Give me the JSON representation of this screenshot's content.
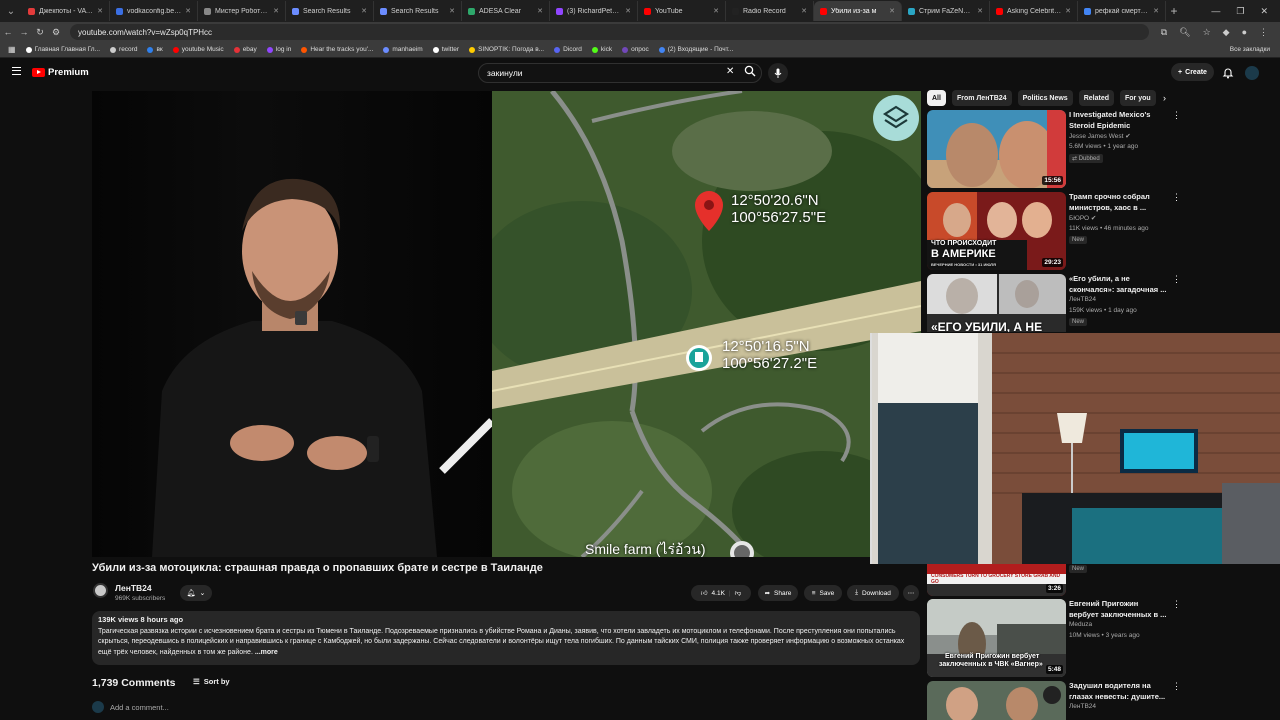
{
  "tabs": [
    {
      "label": "Джекпоты - VAVAD",
      "color": "#e33b3b",
      "active": false
    },
    {
      "label": "vodkaconfig.bet | 5",
      "color": "#3b6fe3",
      "active": false
    },
    {
      "label": "Мистер Робот (1-4",
      "color": "#888888",
      "active": false
    },
    {
      "label": "Search Results",
      "color": "#6b8cff",
      "active": false
    },
    {
      "label": "Search Results",
      "color": "#6b8cff",
      "active": false
    },
    {
      "label": "ADESA Clear",
      "color": "#2ea86b",
      "active": false
    },
    {
      "label": "(3) RichardPetrovic",
      "color": "#9146ff",
      "active": false
    },
    {
      "label": "YouTube",
      "color": "#ff0000",
      "active": false
    },
    {
      "label": "Radio Record",
      "color": "#222222",
      "active": false
    },
    {
      "label": "Убили из-за м",
      "color": "#ff0000",
      "active": true
    },
    {
      "label": "Стрим FaZeNDA67",
      "color": "#2aa6c4",
      "active": false
    },
    {
      "label": "Asking Celebrity Bil",
      "color": "#ff0000",
      "active": false
    },
    {
      "label": "рефкай смерть в",
      "color": "#4285f4",
      "active": false
    }
  ],
  "address": {
    "url": "youtube.com/watch?v=wZsp0qTPHcc"
  },
  "bookmarks": [
    {
      "label": "Главная Главная Гл...",
      "color": "#ffffff"
    },
    {
      "label": "record",
      "color": "#cccccc"
    },
    {
      "label": "вк",
      "color": "#2f80ed"
    },
    {
      "label": "youtube Music",
      "color": "#ff0000"
    },
    {
      "label": "ebay",
      "color": "#e53238"
    },
    {
      "label": "log in",
      "color": "#9146ff"
    },
    {
      "label": "Hear the tracks you'...",
      "color": "#ff5500"
    },
    {
      "label": "manhaeim",
      "color": "#6b8cff"
    },
    {
      "label": "twitter",
      "color": "#ffffff"
    },
    {
      "label": "SINOPTIK: Погода в...",
      "color": "#ffcc00"
    },
    {
      "label": "Dicord",
      "color": "#5865f2"
    },
    {
      "label": "kick",
      "color": "#53fc18"
    },
    {
      "label": "опрос",
      "color": "#7248b9"
    },
    {
      "label": "(2) Входящие - Почт...",
      "color": "#4285f4"
    }
  ],
  "all_bookmarks": "Все закладки",
  "header": {
    "logo": "Premium",
    "search_value": "закинули",
    "create_label": "Create"
  },
  "map": {
    "coord1_lat": "12°50'20.6\"N",
    "coord1_lon": "100°56'27.5\"E",
    "coord2_lat": "12°50'16.5\"N",
    "coord2_lon": "100°56'27.2\"E",
    "place_label": "Smile farm (ไร่อ้วน)"
  },
  "video": {
    "title": "Убили из-за мотоцикла: страшная правда о пропавших брате и сестре в Таиланде",
    "channel": "ЛенТВ24",
    "subscribers": "969K subscribers",
    "likes": "4.1K",
    "share": "Share",
    "save": "Save",
    "download": "Download",
    "views_time": "139K views  8 hours ago",
    "description": "Трагическая развязка истории с исчезновением брата и сестры из Тюмени в Таиланде. Подозреваемые признались в убийстве Романа и Дианы, заявив, что хотели завладеть их мотоциклом и телефонами. После преступления они попытались скрыться, переодевшись в полицейских и направившись к границе с Камбоджей, но были задержаны. Сейчас следователи и волонтёры ищут тела погибших. По данным тайских СМИ, полиция также проверяет информацию о возможных останках ещё трёх человек, найденных в том же районе.",
    "more": "...more"
  },
  "comments": {
    "count": "1,739 Comments",
    "sort": "Sort by",
    "add": "Add a comment..."
  },
  "chips": [
    "All",
    "From ЛенТВ24",
    "Politics News",
    "Related",
    "For you"
  ],
  "recommendations": [
    {
      "title": "I Investigated Mexico's Steroid Epidemic",
      "channel": "Jesse James West",
      "stats": "5.6M views • 1 year ago",
      "badge": "Dubbed",
      "duration": "15:56"
    },
    {
      "title": "Трамп срочно собрал министров, хаос в ...",
      "channel": "БЮРО",
      "stats": "11K views • 46 minutes ago",
      "badge": "New",
      "duration": "29:23",
      "caption1": "ЧТО ПРОИСХОДИТ",
      "caption2": "В АМЕРИКЕ",
      "caption3": "ВЕЧЕРНИЕ НОВОСТИ • 31 ИЮЛЯ"
    },
    {
      "title": "«Его убили, а не скончался»: загадочная ...",
      "channel": "ЛенТВ24",
      "stats": "159K views • 1 day ago",
      "badge": "New",
      "caption1": "«ЕГО УБИЛИ, А НЕ"
    },
    {
      "badge": "New",
      "duration": "3:26",
      "caption1": "CONSUMERS TURN TO GROCERY STORE GRAB AND GO"
    },
    {
      "title": "Евгений Пригожин вербует заключенных в ...",
      "channel": "Meduza",
      "stats": "10M views • 3 years ago",
      "duration": "5:48",
      "caption1": "Евгений Пригожин вербует",
      "caption2": "заключенных в ЧВК «Вагнер»"
    },
    {
      "title": "Задушил водителя на глазах невесты: душите...",
      "channel": "ЛенТВ24"
    }
  ]
}
